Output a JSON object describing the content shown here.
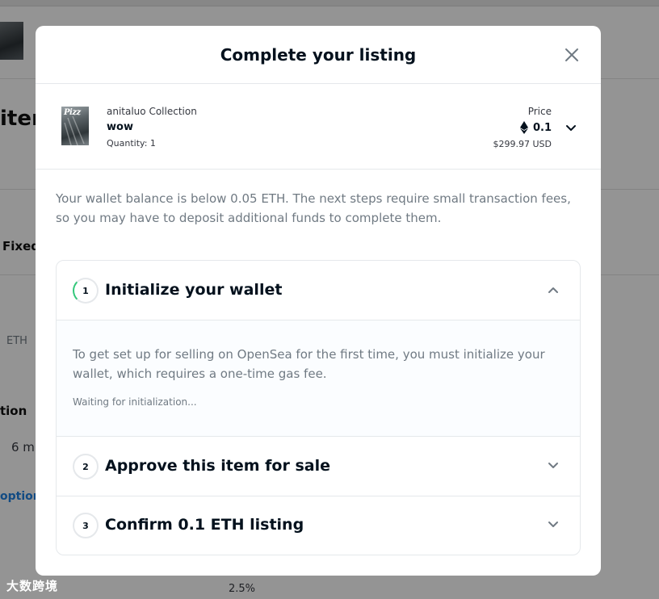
{
  "background": {
    "partial_labels": [
      "iten",
      "Fixed",
      "ETH",
      "tion",
      "6 m",
      "optior",
      "2.5%"
    ]
  },
  "modal": {
    "title": "Complete your listing",
    "close_icon": "close-icon"
  },
  "item": {
    "collection": "anitaluo Collection",
    "name": "wow",
    "quantity": "Quantity: 1",
    "image_text": "Pizz",
    "price_label": "Price",
    "price_value": "0.1",
    "price_usd": "$299.97 USD",
    "currency_icon": "eth-icon"
  },
  "notice": "Your wallet balance is below 0.05 ETH. The next steps require small transaction fees, so you may have to deposit additional funds to complete them.",
  "steps": [
    {
      "number": "1",
      "title": "Initialize your wallet",
      "expanded": true,
      "description": "To get set up for selling on OpenSea for the first time, you must initialize your wallet, which requires a one-time gas fee.",
      "status": "Waiting for initialization..."
    },
    {
      "number": "2",
      "title": "Approve this item for sale",
      "expanded": false
    },
    {
      "number": "3",
      "title": "Confirm 0.1 ETH listing",
      "expanded": false
    }
  ],
  "watermark": "大数跨境",
  "colors": {
    "accent_green": "#34c77b",
    "text_primary": "#04111d",
    "text_secondary": "#707a83",
    "border": "#e5e8eb"
  }
}
